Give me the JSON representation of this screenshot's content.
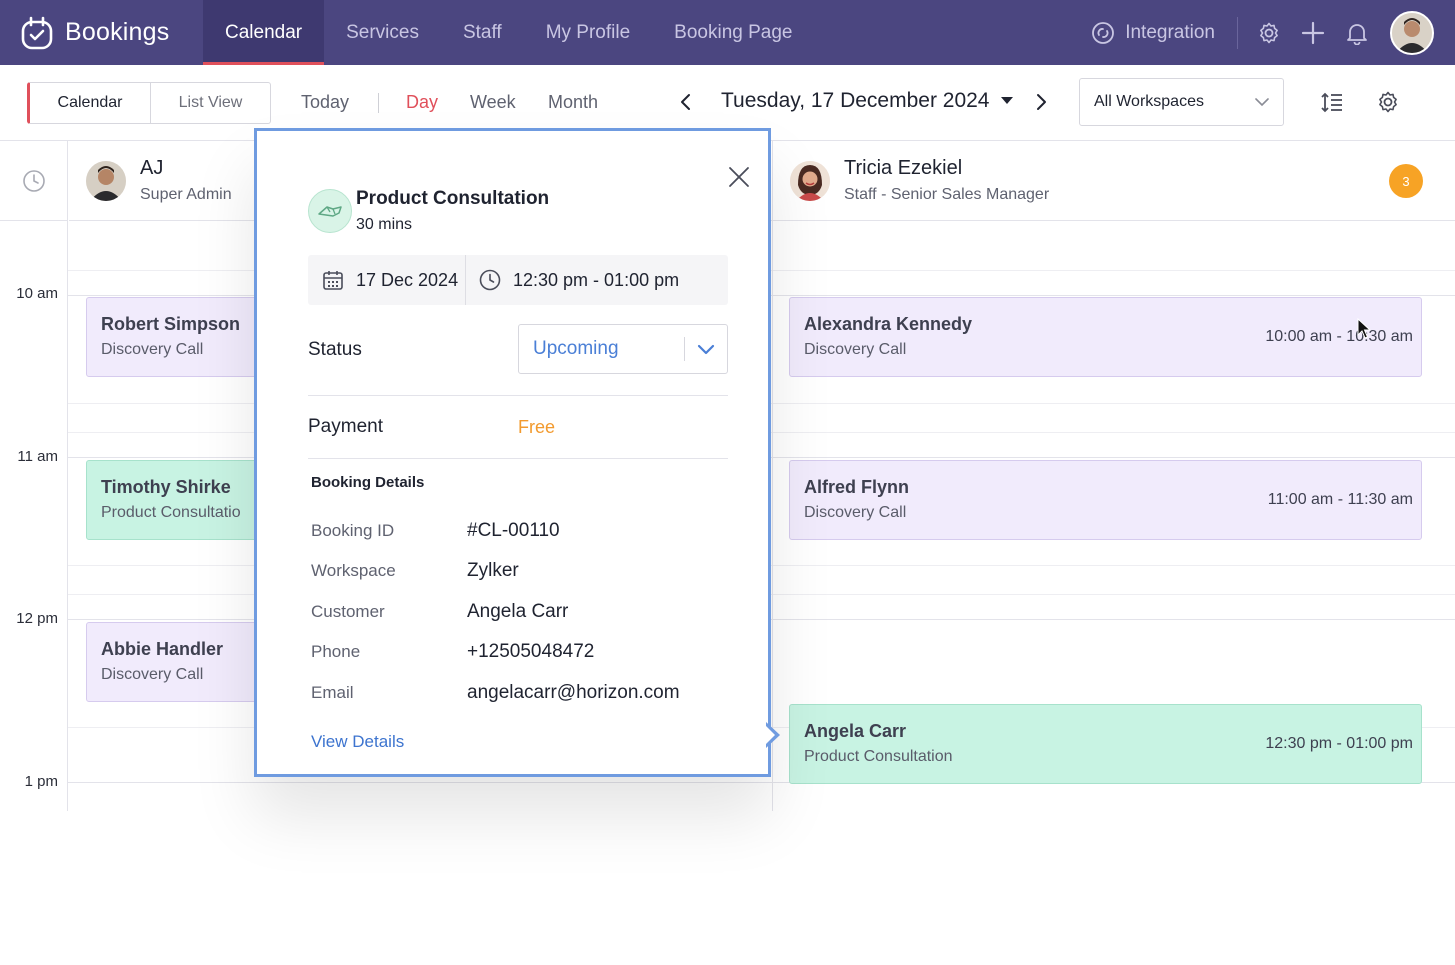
{
  "app": {
    "name": "Bookings"
  },
  "nav": {
    "tabs": [
      {
        "label": "Calendar",
        "active": true
      },
      {
        "label": "Services"
      },
      {
        "label": "Staff"
      },
      {
        "label": "My Profile"
      },
      {
        "label": "Booking Page"
      }
    ],
    "integration_label": "Integration"
  },
  "toolbar": {
    "view_toggle": {
      "calendar": "Calendar",
      "list": "List View"
    },
    "today": "Today",
    "day": "Day",
    "week": "Week",
    "month": "Month",
    "active_view": "Day",
    "date_title": "Tuesday, 17 December 2024",
    "workspace": "All Workspaces"
  },
  "calendar": {
    "time_labels": [
      "10 am",
      "11 am",
      "12 pm",
      "1 pm"
    ],
    "staff": [
      {
        "name": "AJ",
        "role": "Super Admin"
      },
      {
        "name": "Tricia Ezekiel",
        "role": "Staff - Senior Sales Manager",
        "badge": "3"
      }
    ],
    "events_left": [
      {
        "name": "Robert Simpson",
        "service": "Discovery Call",
        "color": "purple"
      },
      {
        "name": "Timothy Shirke",
        "service": "Product Consultatio",
        "color": "green"
      },
      {
        "name": "Abbie Handler",
        "service": "Discovery Call",
        "color": "purple"
      }
    ],
    "events_right": [
      {
        "name": "Alexandra Kennedy",
        "service": "Discovery Call",
        "time": "10:00 am - 10:30 am",
        "color": "purple"
      },
      {
        "name": "Alfred Flynn",
        "service": "Discovery Call",
        "time": "11:00 am - 11:30 am",
        "color": "purple"
      },
      {
        "name": "Angela Carr",
        "service": "Product Consultation",
        "time": "12:30 pm - 01:00 pm",
        "color": "green"
      }
    ]
  },
  "popup": {
    "service_title": "Product Consultation",
    "duration": "30 mins",
    "date": "17 Dec 2024",
    "time": "12:30 pm - 01:00 pm",
    "status_label": "Status",
    "status_value": "Upcoming",
    "payment_label": "Payment",
    "payment_value": "Free",
    "details_title": "Booking Details",
    "details": [
      {
        "label": "Booking ID",
        "value": "#CL-00110"
      },
      {
        "label": "Workspace",
        "value": "Zylker"
      },
      {
        "label": "Customer",
        "value": "Angela Carr"
      },
      {
        "label": "Phone",
        "value": "+12505048472"
      },
      {
        "label": "Email",
        "value": "angelacarr@horizon.com"
      }
    ],
    "view_details": "View Details"
  },
  "colors": {
    "nav_bg": "#4b4680",
    "accent_red": "#e0505b",
    "popup_border": "#6f9be0",
    "status_blue": "#4a7fd6",
    "payment_orange": "#f29a2e",
    "badge_orange": "#f7a325",
    "event_purple": "#f1ebfc",
    "event_green": "#c8f3e3"
  },
  "icons": [
    "bookings-logo-icon",
    "integration-icon",
    "settings-icon",
    "plus-icon",
    "bell-icon",
    "clock-icon",
    "calendar-icon",
    "close-icon",
    "chevron-down-icon",
    "chevron-left-icon",
    "chevron-right-icon",
    "density-icon",
    "service-icon"
  ]
}
